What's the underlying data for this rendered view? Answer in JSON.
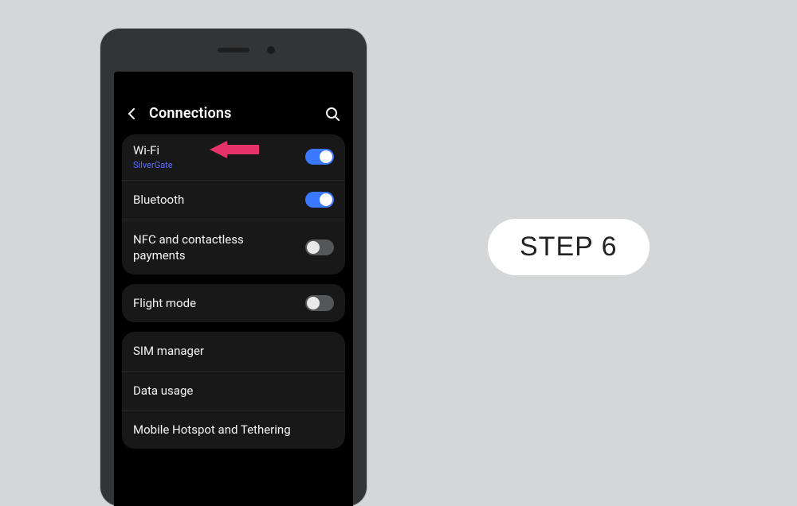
{
  "header": {
    "title": "Connections"
  },
  "callout": {
    "arrow_color": "#e6326a"
  },
  "groups": [
    {
      "rows": [
        {
          "label": "Wi-Fi",
          "sublabel": "SilverGate",
          "toggle": true,
          "interactable": true,
          "name": "wifi-row"
        },
        {
          "label": "Bluetooth",
          "toggle": true,
          "interactable": true,
          "name": "bluetooth-row"
        },
        {
          "label": "NFC and contactless payments",
          "toggle": false,
          "interactable": true,
          "name": "nfc-row"
        }
      ]
    },
    {
      "rows": [
        {
          "label": "Flight mode",
          "toggle": false,
          "interactable": true,
          "name": "flight-mode-row"
        }
      ]
    },
    {
      "rows": [
        {
          "label": "SIM manager",
          "interactable": true,
          "name": "sim-manager-row"
        },
        {
          "label": "Data usage",
          "interactable": true,
          "name": "data-usage-row"
        },
        {
          "label": "Mobile Hotspot and Tethering",
          "interactable": true,
          "name": "hotspot-row"
        }
      ]
    }
  ],
  "step_label": "STEP 6"
}
